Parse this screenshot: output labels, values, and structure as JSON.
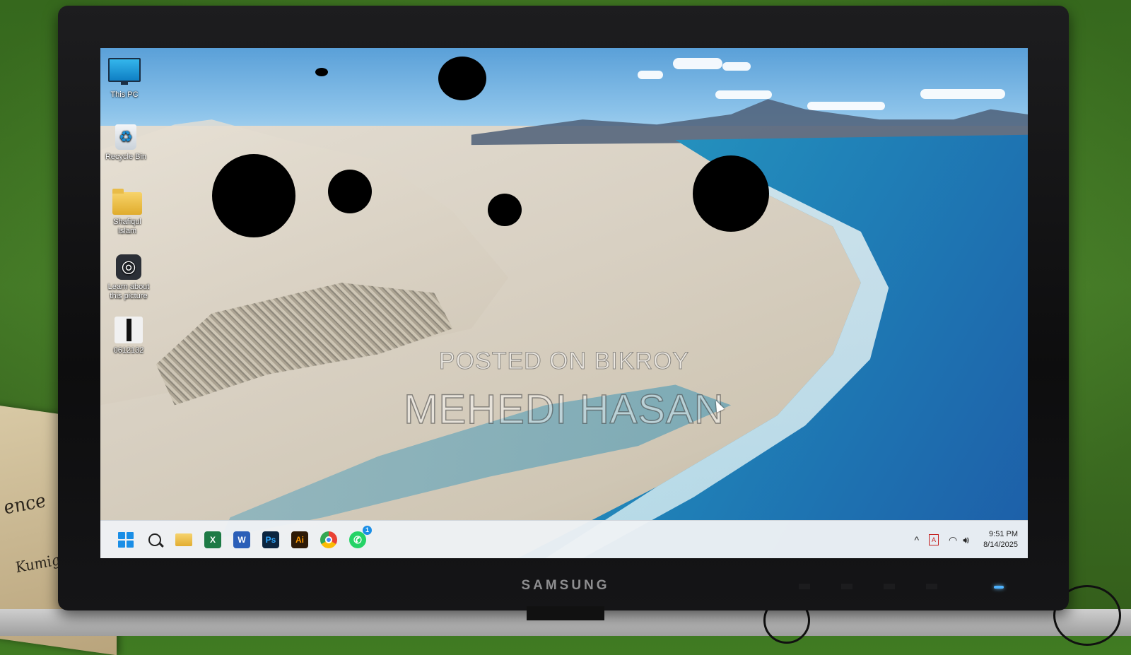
{
  "desktop": {
    "icons": [
      {
        "label": "This PC",
        "icon": "monitor-icon"
      },
      {
        "label": "Recycle Bin",
        "icon": "recycle-bin-icon"
      },
      {
        "label": "Shafiqul Islam",
        "icon": "folder-icon"
      },
      {
        "label": "Learn about this picture",
        "icon": "camera-icon"
      },
      {
        "label": "0612132",
        "icon": "image-file-icon"
      }
    ]
  },
  "watermark": {
    "line1": "POSTED ON BIKROY",
    "line2": "MEHEDI HASAN"
  },
  "taskbar": {
    "apps": [
      {
        "name": "Start",
        "icon": "windows-icon"
      },
      {
        "name": "Search",
        "icon": "search-icon"
      },
      {
        "name": "File Explorer",
        "icon": "folder-icon"
      },
      {
        "name": "Excel",
        "icon": "excel-icon",
        "label": "X"
      },
      {
        "name": "Word",
        "icon": "word-icon",
        "label": "W"
      },
      {
        "name": "Photoshop",
        "icon": "photoshop-icon",
        "label": "Ps"
      },
      {
        "name": "Illustrator",
        "icon": "illustrator-icon",
        "label": "Ai"
      },
      {
        "name": "Chrome",
        "icon": "chrome-icon"
      },
      {
        "name": "WhatsApp",
        "icon": "whatsapp-icon",
        "badge": "1"
      }
    ],
    "tray": {
      "chevron": "^",
      "time": "9:51 PM",
      "date": "8/14/2025"
    }
  },
  "monitor": {
    "brand": "SAMSUNG"
  }
}
